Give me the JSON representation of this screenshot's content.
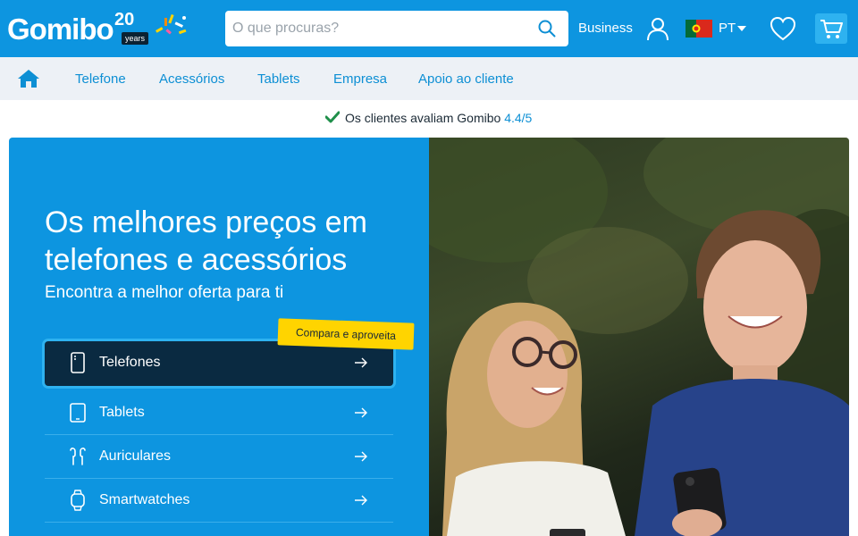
{
  "header": {
    "logo_text": "Gomibo",
    "logo_anniversary_number": "20",
    "logo_anniversary_word": "years",
    "search_placeholder": "O que procuras?",
    "business_label": "Business",
    "language_code": "PT",
    "brand_color": "#0d95e0",
    "icons": [
      "search-icon",
      "user-icon",
      "portugal-flag-icon",
      "heart-icon",
      "cart-icon"
    ]
  },
  "nav": {
    "items": [
      {
        "label": "Telefone"
      },
      {
        "label": "Acessórios"
      },
      {
        "label": "Tablets"
      },
      {
        "label": "Empresa"
      },
      {
        "label": "Apoio ao cliente"
      }
    ]
  },
  "trust": {
    "text": "Os clientes avaliam Gomibo",
    "score": "4.4/5"
  },
  "hero": {
    "title": "Os melhores preços em telefones e acessórios",
    "subtitle": "Encontra a melhor oferta para ti",
    "promo_badge": "Compara e aproveita",
    "categories": [
      {
        "label": "Telefones",
        "icon": "phone-icon"
      },
      {
        "label": "Tablets",
        "icon": "tablet-icon"
      },
      {
        "label": "Auriculares",
        "icon": "earbuds-icon"
      },
      {
        "label": "Smartwatches",
        "icon": "smartwatch-icon"
      }
    ],
    "accent_color": "#ffd400",
    "active_item_color": "#0a2a41"
  }
}
